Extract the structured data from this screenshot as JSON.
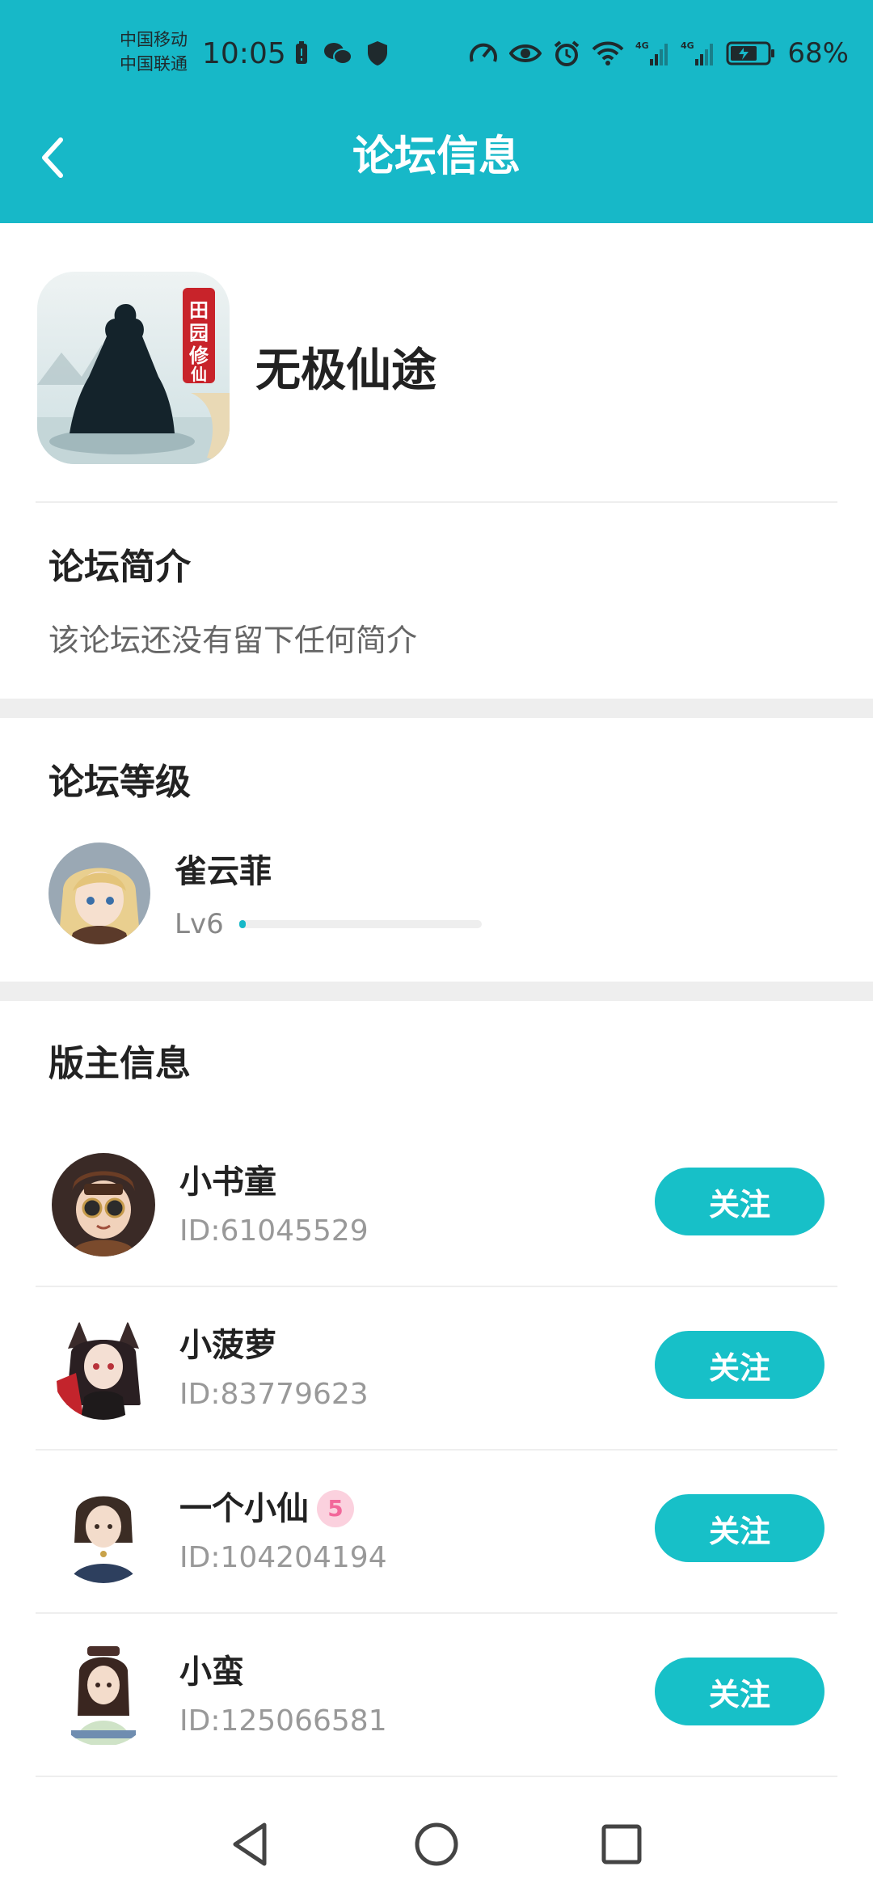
{
  "status_bar": {
    "carrier_line1": "中国移动",
    "carrier_line2": "中国联通",
    "time": "10:05",
    "battery": "68%",
    "left_icons": [
      "battery-alert-icon",
      "wechat-icon",
      "shield-icon"
    ],
    "right_icons": [
      "speedometer-icon",
      "eye-icon",
      "alarm-icon",
      "wifi-icon",
      "signal-4g-icon",
      "signal-4g-icon",
      "battery-icon"
    ]
  },
  "nav": {
    "title": "论坛信息",
    "back_icon": "chevron-left-icon"
  },
  "forum": {
    "name": "无极仙途",
    "icon_badge": [
      "田园",
      "修仙"
    ]
  },
  "intro": {
    "title": "论坛简介",
    "text": "该论坛还没有留下任何简介"
  },
  "level": {
    "title": "论坛等级",
    "user": "雀云菲",
    "lv": "Lv6",
    "progress": 0.02
  },
  "moderators": {
    "title": "版主信息",
    "follow_label": "关注",
    "items": [
      {
        "name": "小书童",
        "id": "ID:61045529",
        "badge": ""
      },
      {
        "name": "小菠萝",
        "id": "ID:83779623",
        "badge": ""
      },
      {
        "name": "一个小仙",
        "id": "ID:104204194",
        "badge": "5"
      },
      {
        "name": "小蛮",
        "id": "ID:125066581",
        "badge": ""
      }
    ]
  },
  "system_nav": [
    "back-triangle-icon",
    "home-circle-icon",
    "recents-square-icon"
  ],
  "colors": {
    "accent": "#17b8c8",
    "follow_button": "#17c0c8",
    "divider": "#eeeeee"
  }
}
